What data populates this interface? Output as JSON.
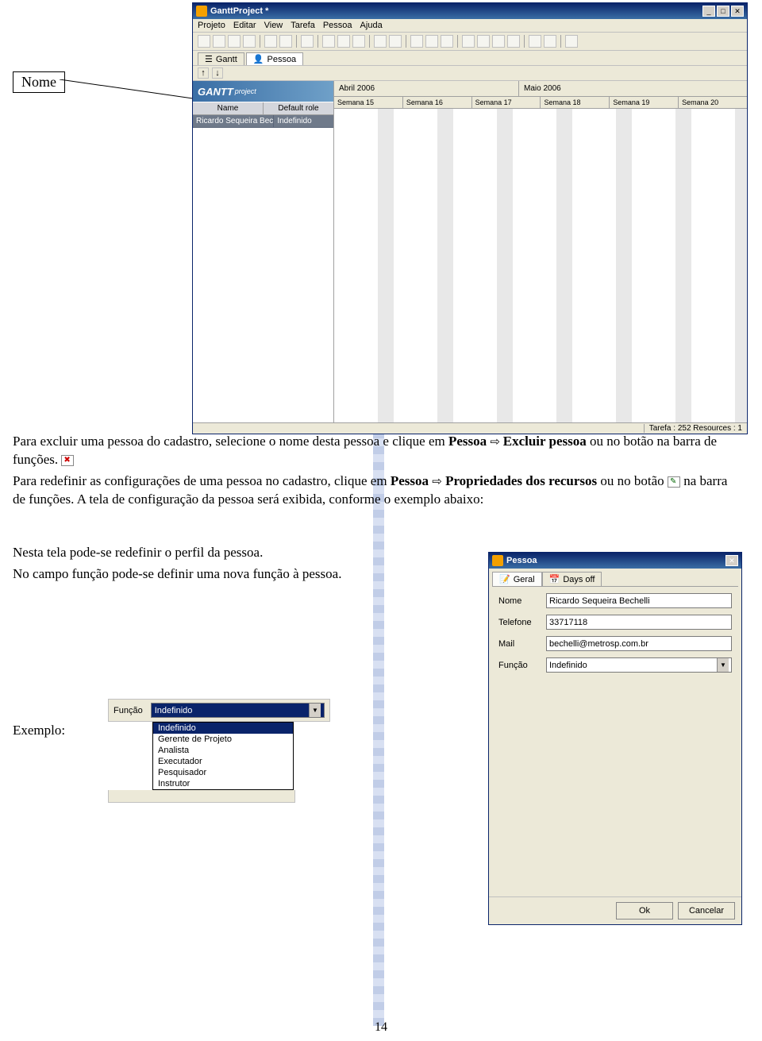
{
  "callout": {
    "label": "Nome"
  },
  "app": {
    "title": "GanttProject *",
    "menu": [
      "Projeto",
      "Editar",
      "View",
      "Tarefa",
      "Pessoa",
      "Ajuda"
    ],
    "tabs": {
      "gantt": "Gantt",
      "pessoa": "Pessoa"
    },
    "left": {
      "logo": "GANTT",
      "logo_sub": "project",
      "col_name": "Name",
      "col_role": "Default role",
      "row_name": "Ricardo Sequeira Bechelli",
      "row_role": "Indefinido"
    },
    "timeline": {
      "months": [
        "Abril 2006",
        "Maio 2006"
      ],
      "weeks": [
        "Semana 15",
        "Semana 16",
        "Semana 17",
        "Semana 18",
        "Semana 19",
        "Semana 20"
      ]
    },
    "status": {
      "left": "",
      "right": "Tarefa : 252 Resources : 1"
    }
  },
  "doc": {
    "p1a": "Para excluir uma pessoa do cadastro, selecione o nome desta pessoa e clique em ",
    "p1b": "Pessoa",
    "p1c": " Excluir pessoa",
    "p1d": "  ou no botão na barra de funções.",
    "p2a": "Para redefinir as configurações de uma pessoa no cadastro, clique em ",
    "p2b": "Pessoa",
    "p2c": "Propriedades dos recursos",
    "p2d": " ou no botão ",
    "p2e": "na barra de funções. A tela de configuração da pessoa será exibida, conforme o exemplo abaixo:",
    "p3": "Nesta tela pode-se redefinir o perfil da pessoa.",
    "p4": "No campo função pode-se definir uma nova função à pessoa.",
    "exemplo": "Exemplo:"
  },
  "pessoa": {
    "title": "Pessoa",
    "tab_geral": "Geral",
    "tab_daysoff": "Days off",
    "labels": {
      "nome": "Nome",
      "tel": "Telefone",
      "mail": "Mail",
      "funcao": "Função"
    },
    "values": {
      "nome": "Ricardo Sequeira Bechelli",
      "tel": "33717118",
      "mail": "bechelli@metrosp.com.br",
      "funcao": "Indefinido"
    },
    "ok": "Ok",
    "cancel": "Cancelar"
  },
  "funcao": {
    "label": "Função",
    "selected": "Indefinido",
    "options": [
      "Indefinido",
      "Gerente de Projeto",
      "Analista",
      "Executador",
      "Pesquisador",
      "Instrutor"
    ]
  },
  "page_num": "14"
}
